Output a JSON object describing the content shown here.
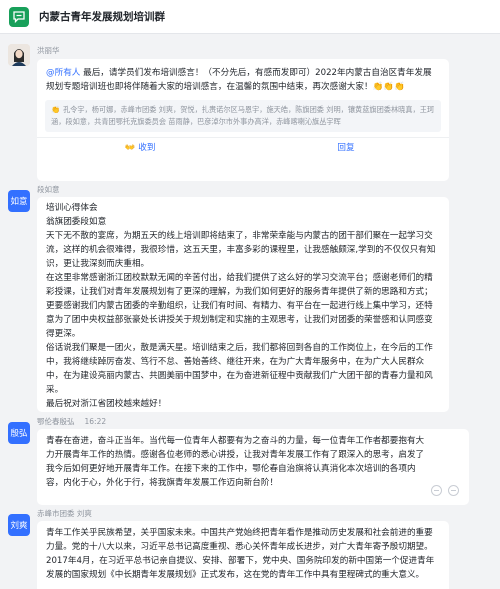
{
  "header": {
    "title": "内蒙古青年发展规划培训群"
  },
  "messages": [
    {
      "sender": "洪丽华",
      "mention": "@所有人",
      "text": " 最后，请学员们发布培训感言！（不分先后，有感而发即可）2022年内蒙古自治区青年发展规划专题培训班也即将伴随着大家的培训感言，在温馨的氛围中结束，再次感谢大家！",
      "text_emoji": "👏👏👏",
      "reactions": "孔令宇，杨可娜，赤峰市团委 刘爽，贺悦，扎赉诺尔区马恩宇，施天皓，陈旗团委 刘明，镶黄蓝旗团委林晓真，王珂涵，段如意，共青团鄂托克旗委员会 苗雨静，巴彦淖尔市外事办高洋，赤峰喀喇沁旗丛宇晖",
      "reaction_icon": "👏",
      "btn_received": "收到",
      "btn_received_icon": "👐",
      "btn_reply": "回复"
    },
    {
      "sender": "段如意",
      "avatar_text": "如意",
      "avatar_color": "#3370ff",
      "paragraphs": [
        "培训心得体会",
        "翁旗团委段如意",
        "天下无不散的宴席，为期五天的线上培训即将结束了，非常荣幸能与内蒙古的团干部们聚在一起学习交流，这样的机会很难得，我很珍惜，这五天里，丰富多彩的课程里，让我感触颇深,学到的不仅仅只有知识，更让我深刻而庆重相。",
        "在这里非常感谢浙江团校默默无闻的辛苦付出，给我们提供了这么好的学习交流平台；感谢老师们的精彩授课，让我们对青年发展规划有了更深的理解，为我们如何更好的服务青年提供了新的思路和方式；更要感谢我们内蒙古团委的辛勤组织，让我们有时间、有精力、有平台在一起进行线上集中学习，还特意为了团中央权益部张豪处长讲授关于规划制定和实施的主观思考，让我们对团委的荣誉感和认同感变得更深。",
        "俗话说我们聚是一团火，散是满天星。培训结束之后，我们都将回到各自的工作岗位上，在今后的工作中，我将继续踔厉奋发、笃行不怠、善始善终、继往开来，在为广大青年服务中，在为广大人民群众中，在为建设亮丽内蒙古、共圆美丽中国梦中，在为奋进新征程中贡献我们广大团干部的青春力量和风采。",
        "最后祝对浙江省团校越来越好！"
      ]
    },
    {
      "sender": "鄂伦春殷弘",
      "time": "16:22",
      "avatar_text": "殷弘",
      "avatar_color": "#3370ff",
      "text": "青春在奋进，奋斗正当年。当代每一位青年人都要有为之奋斗的力量，每一位青年工作者都要抱有大力开展青年工作的热情。感谢各位老师的悉心讲授，让我对青年发展工作有了跟深入的思考，启发了我今后如何更好地开展青年工作。在接下来的工作中，鄂伦春自治旗将认真消化本次培训的各项内容，内化于心，外化于行，将我旗青年发展工作迈向新台阶！"
    },
    {
      "sender": "赤峰市团委 刘爽",
      "avatar_text": "刘爽",
      "avatar_color": "#3370ff",
      "text": "青年工作关乎民族希望，关乎国家未来。中国共产党始终把青年看作是推动历史发展和社会前进的重要力量。党的十八大以来，习近平总书记高度重视、悉心关怀青年成长进步，对广大青年寄予殷切期望。2017年4月，在习近平总书记亲自提议、安排、部署下，党中央、国务院印发的新中国第一个促进青年发展的国家规划《中长期青年发展规划》正式发布，这在党的青年工作中具有里程碑式的重大意义。"
    }
  ],
  "colors": {
    "accent": "#3370ff",
    "app_green": "#18a05a",
    "bg": "#f2f3f5"
  },
  "icons": {
    "group_avatar": "chat-bubble-icon"
  }
}
